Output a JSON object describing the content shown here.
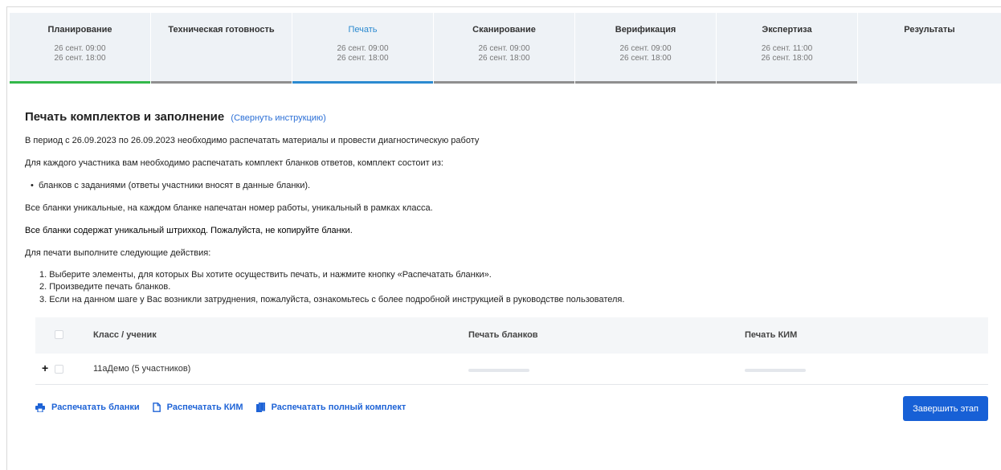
{
  "stages": [
    {
      "title": "Планирование",
      "time_start": "26 сент. 09:00",
      "time_end": "26 сент. 18:00",
      "status": "done"
    },
    {
      "title": "Техническая готовность",
      "time_start": "",
      "time_end": "",
      "status": "pending"
    },
    {
      "title": "Печать",
      "time_start": "26 сент. 09:00",
      "time_end": "26 сент. 18:00",
      "status": "active"
    },
    {
      "title": "Сканирование",
      "time_start": "26 сент. 09:00",
      "time_end": "26 сент. 18:00",
      "status": "pending"
    },
    {
      "title": "Верификация",
      "time_start": "26 сент. 09:00",
      "time_end": "26 сент. 18:00",
      "status": "pending"
    },
    {
      "title": "Экспертиза",
      "time_start": "26 сент. 11:00",
      "time_end": "26 сент. 18:00",
      "status": "pending"
    },
    {
      "title": "Результаты",
      "time_start": "",
      "time_end": "",
      "status": "none"
    }
  ],
  "instructions": {
    "heading": "Печать комплектов и заполнение",
    "toggle_link": "(Свернуть инструкцию)",
    "period_text": "В период с 26.09.2023 по 26.09.2023 необходимо распечатать материалы и провести диагностическую работу",
    "set_intro": "Для каждого участника вам необходимо распечатать комплект бланков ответов, комплект состоит из:",
    "set_items": [
      "бланков с заданиями (ответы участники вносят в данные бланки)."
    ],
    "unique_text": "Все бланки уникальные, на каждом бланке напечатан номер работы, уникальный в рамках класса.",
    "barcode_warning": "Все бланки содержат уникальный штрихкод. Пожалуйста, не копируйте бланки.",
    "steps_intro": "Для печати выполните следующие действия:",
    "steps": [
      "1. Выберите элементы, для которых Вы хотите осуществить печать, и нажмите кнопку «Распечатать бланки».",
      "2. Произведите печать бланков.",
      "3. Если на данном шаге у Вас возникли затруднения, пожалуйста, ознакомьтесь с более подробной инструкцией в руководстве пользователя."
    ]
  },
  "table": {
    "columns": [
      "Класс / ученик",
      "Печать бланков",
      "Печать КИМ"
    ],
    "rows": [
      {
        "name": "11аДемо (5 участников)",
        "expand_icon": "plus-icon"
      }
    ]
  },
  "actions": {
    "print_forms": "Распечатать бланки",
    "print_kim": "Распечатать КИМ",
    "print_full": "Распечатать полный комплект",
    "finish": "Завершить этап"
  },
  "colors": {
    "accent": "#1760d6",
    "stage_done": "#33b84a",
    "stage_active": "#2b8ad0",
    "stage_pending": "#8f8f8f",
    "stages_bg": "#eef2f6"
  },
  "icons": {
    "print_forms": "printer-icon",
    "print_kim": "document-icon",
    "print_full": "documents-stack-icon"
  }
}
